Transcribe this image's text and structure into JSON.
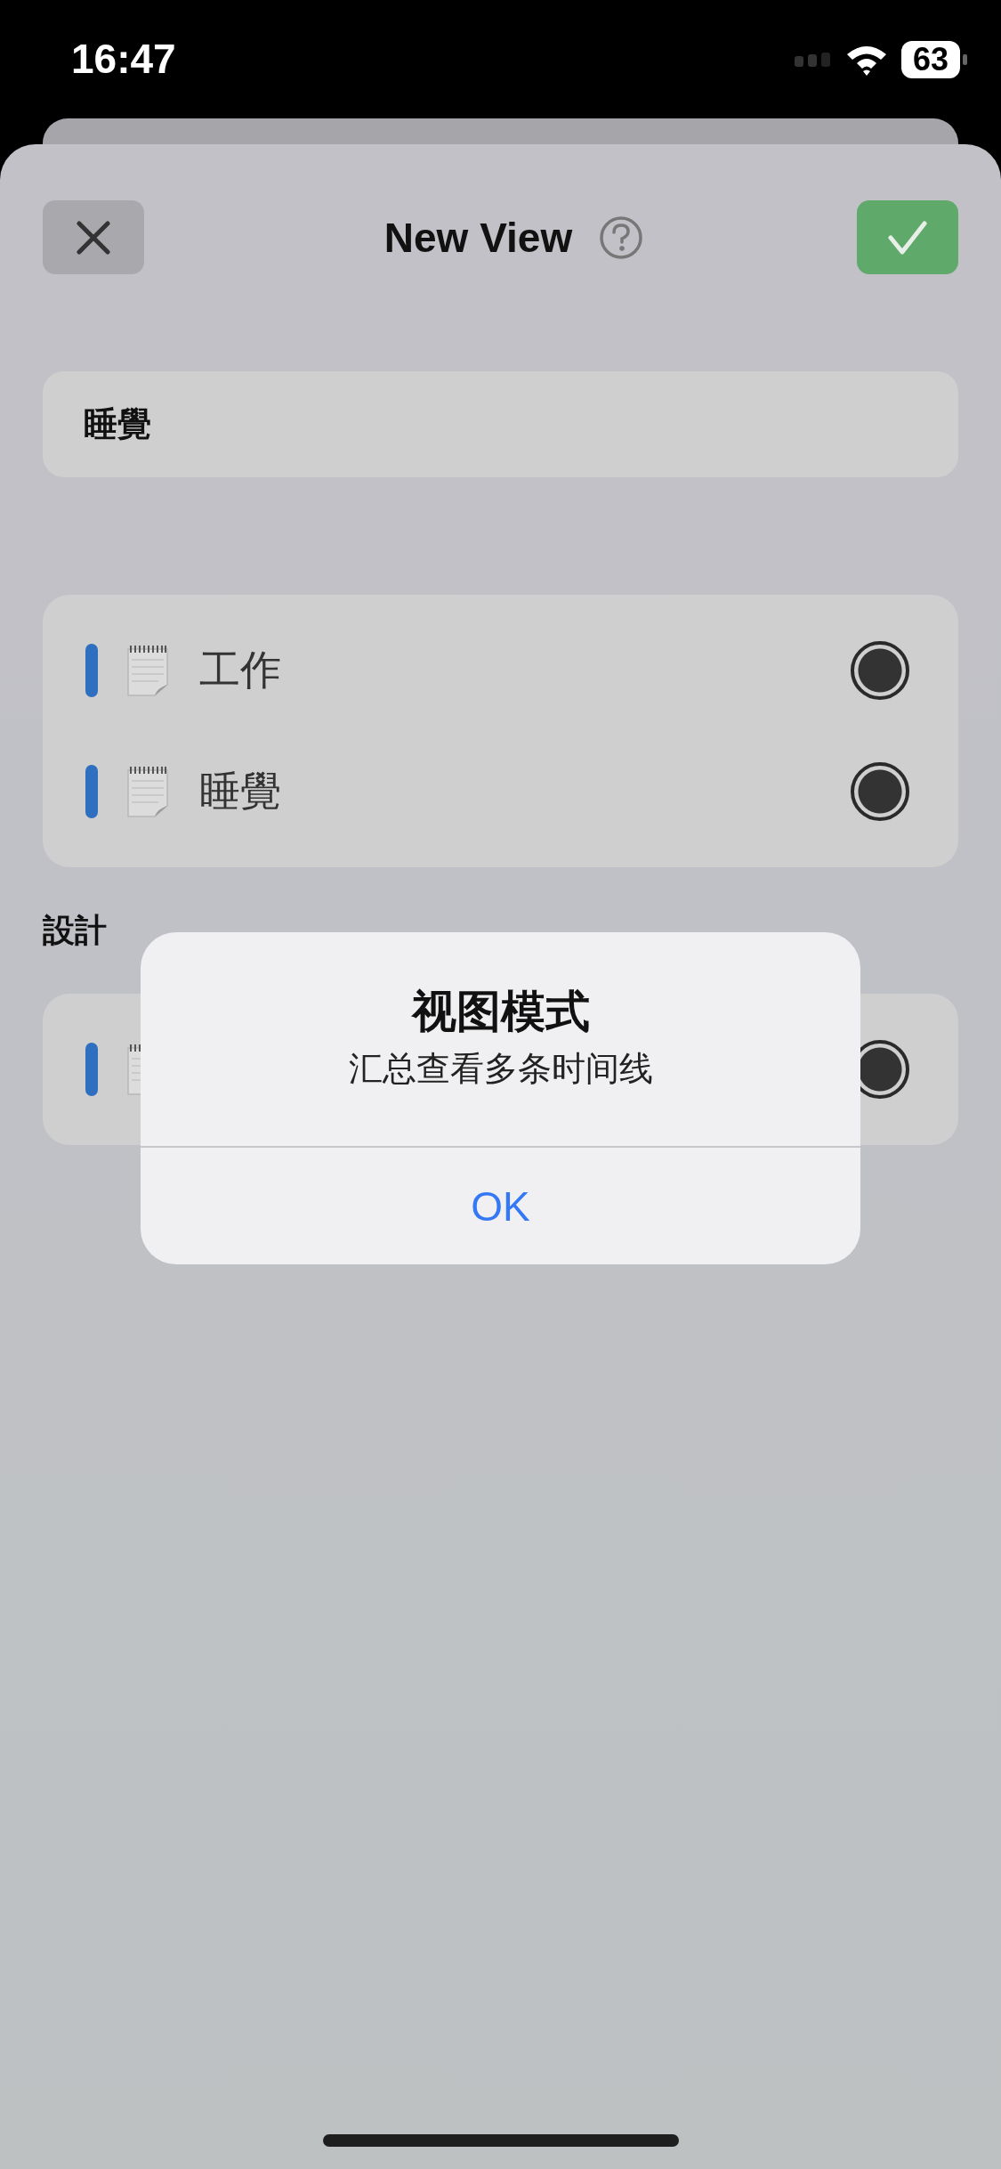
{
  "status_bar": {
    "time": "16:47",
    "battery": "63"
  },
  "header": {
    "title": "New View"
  },
  "name_field": {
    "value": "睡覺"
  },
  "groups": [
    {
      "rows": [
        {
          "label": "工作",
          "selected": true
        },
        {
          "label": "睡覺",
          "selected": true
        }
      ]
    },
    {
      "title": "設計",
      "rows": [
        {
          "selected": true
        }
      ]
    }
  ],
  "alert": {
    "title": "视图模式",
    "message": "汇总查看多条时间线",
    "button": "OK"
  }
}
